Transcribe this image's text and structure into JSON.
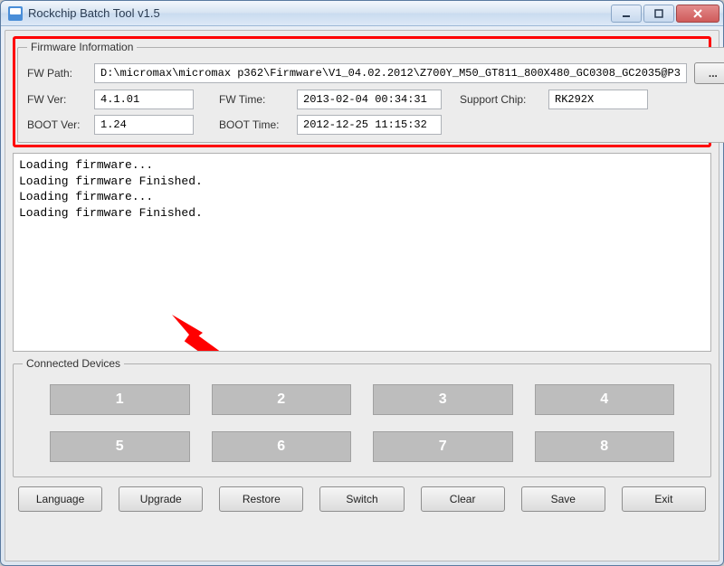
{
  "window": {
    "title": "Rockchip Batch Tool v1.5"
  },
  "firmware": {
    "legend": "Firmware Information",
    "labels": {
      "path": "FW Path:",
      "ver": "FW Ver:",
      "time": "FW Time:",
      "chip": "Support Chip:",
      "boot_ver": "BOOT Ver:",
      "boot_time": "BOOT Time:"
    },
    "values": {
      "path": "D:\\micromax\\micromax p362\\Firmware\\V1_04.02.2012\\Z700Y_M50_GT811_800X480_GC0308_GC2035@P3",
      "ver": "4.1.01",
      "time": "2013-02-04 00:34:31",
      "chip": "RK292X",
      "boot_ver": "1.24",
      "boot_time": "2012-12-25 11:15:32"
    },
    "browse_label": "..."
  },
  "log_lines": "Loading firmware...\nLoading firmware Finished.\nLoading firmware...\nLoading firmware Finished.",
  "devices": {
    "legend": "Connected Devices",
    "slots": [
      "1",
      "2",
      "3",
      "4",
      "5",
      "6",
      "7",
      "8"
    ]
  },
  "buttons": {
    "language": "Language",
    "upgrade": "Upgrade",
    "restore": "Restore",
    "switch": "Switch",
    "clear": "Clear",
    "save": "Save",
    "exit": "Exit"
  },
  "colors": {
    "highlight_border": "#ff0000",
    "arrow": "#ff0000"
  }
}
